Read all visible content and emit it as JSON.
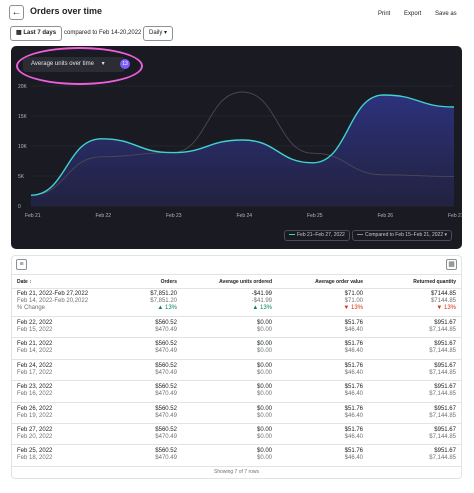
{
  "header": {
    "back_icon": "arrow-left-icon",
    "title": "Orders over time",
    "actions": [
      "Print",
      "Export",
      "Save as"
    ]
  },
  "filters": {
    "date_range": "Last 7 days",
    "compare_text": "compared to Feb 14-20,2022",
    "period": "Daily"
  },
  "chart": {
    "metric_label": "Average units over time",
    "metric_badge": "13",
    "legend": [
      "Feb 21–Feb 27, 2022",
      "Compared to Feb 15–Feb 21, 2022"
    ],
    "colors": {
      "current": "#3fd3cf",
      "compare": "#4a4a52",
      "fill": "#2a2d6b",
      "background": "#1a1a22",
      "highlight": "#ec5fd9"
    }
  },
  "chart_data": {
    "type": "area",
    "x": [
      "Feb 21",
      "Feb 22",
      "Feb 23",
      "Feb 24",
      "Feb 25",
      "Feb 26",
      "Feb 27"
    ],
    "yticks": [
      "0",
      "5K",
      "10K",
      "15K",
      "20K"
    ],
    "ylim": [
      0,
      20000
    ],
    "series": [
      {
        "name": "Feb 21–Feb 27, 2022",
        "values": [
          1800,
          11200,
          8900,
          11000,
          7200,
          18500,
          16500
        ]
      },
      {
        "name": "Compared to Feb 15–Feb 21, 2022",
        "values": [
          1800,
          8200,
          8900,
          19000,
          8800,
          5200,
          4900
        ]
      }
    ]
  },
  "table": {
    "tool_icons": [
      "filter-icon",
      "columns-icon"
    ],
    "columns": [
      "Date ↕",
      "Orders",
      "Average units ordered",
      "Average order value",
      "Returned quantity"
    ],
    "summary": {
      "date": "Feb 21, 2022-Feb 27,2022",
      "date_compare": "Feb 14, 2022-Feb 20,2022",
      "change_label": "% Change",
      "values": [
        "$7,851.20",
        "-$41.99",
        "$71.00",
        "$7144.85"
      ],
      "compare_values": [
        "$7,851.20",
        "-$41.99",
        "$71.00",
        "$7144.85"
      ],
      "changes": [
        "▲ 13%",
        "▲ 13%",
        "▼ 13%",
        "▼ 13%"
      ]
    },
    "rows": [
      {
        "date": "Feb 22, 2022",
        "date_compare": "Feb 15, 2022",
        "values": [
          "$560.52",
          "$0.00",
          "$51.76",
          "$951.67"
        ],
        "compare_values": [
          "$470.49",
          "$0.00",
          "$46.40",
          "$7,144.85"
        ]
      },
      {
        "date": "Feb 21, 2022",
        "date_compare": "Feb 14, 2022",
        "values": [
          "$560.52",
          "$0.00",
          "$51.76",
          "$951.67"
        ],
        "compare_values": [
          "$470.49",
          "$0.00",
          "$46.40",
          "$7,144.85"
        ]
      },
      {
        "date": "Feb 24, 2022",
        "date_compare": "Feb 17, 2022",
        "values": [
          "$560.52",
          "$0.00",
          "$51.76",
          "$951.67"
        ],
        "compare_values": [
          "$470.49",
          "$0.00",
          "$46.40",
          "$7,144.85"
        ]
      },
      {
        "date": "Feb 23, 2022",
        "date_compare": "Feb 16, 2022",
        "values": [
          "$560.52",
          "$0.00",
          "$51.76",
          "$951.67"
        ],
        "compare_values": [
          "$470.49",
          "$0.00",
          "$46.40",
          "$7,144.85"
        ]
      },
      {
        "date": "Feb 26, 2022",
        "date_compare": "Feb 19, 2022",
        "values": [
          "$560.52",
          "$0.00",
          "$51.76",
          "$951.67"
        ],
        "compare_values": [
          "$470.49",
          "$0.00",
          "$46.40",
          "$7,144.85"
        ]
      },
      {
        "date": "Feb 27, 2022",
        "date_compare": "Feb 20, 2022",
        "values": [
          "$560.52",
          "$0.00",
          "$51.76",
          "$951.67"
        ],
        "compare_values": [
          "$470.49",
          "$0.00",
          "$46.40",
          "$7,144.85"
        ]
      },
      {
        "date": "Feb 25, 2022",
        "date_compare": "Feb 18, 2022",
        "values": [
          "$560.52",
          "$0.00",
          "$51.76",
          "$951.67"
        ],
        "compare_values": [
          "$470.49",
          "$0.00",
          "$46.40",
          "$7,144.85"
        ]
      }
    ],
    "footer": "Showing 7 of 7 rows"
  }
}
